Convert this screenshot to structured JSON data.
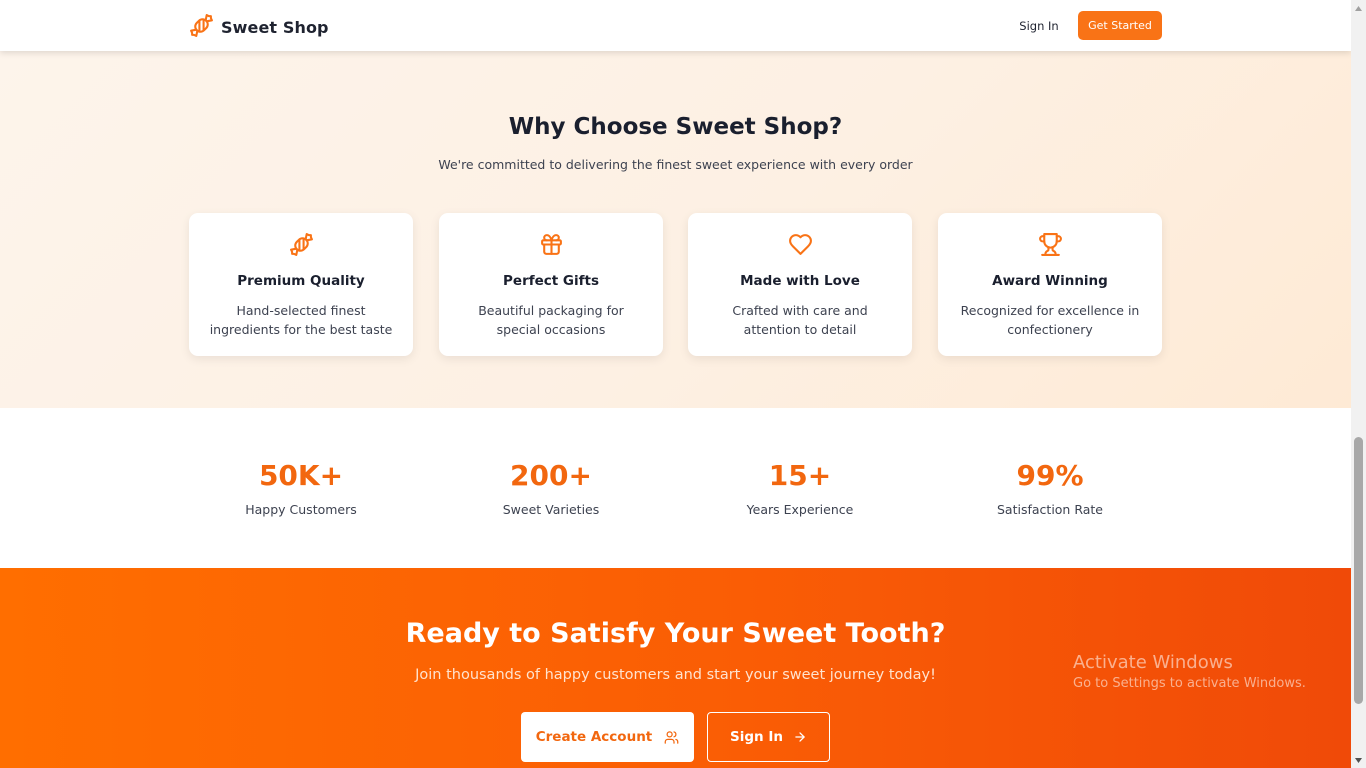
{
  "header": {
    "brand_name": "Sweet Shop",
    "brand_icon": "candy-icon",
    "sign_in_label": "Sign In",
    "cta_label": "Get Started"
  },
  "why": {
    "title": "Why Choose Sweet Shop?",
    "subtitle": "We're committed to delivering the finest sweet experience with every order",
    "features": [
      {
        "icon": "candy-icon",
        "title": "Premium Quality",
        "description": "Hand-selected finest ingredients for the best taste"
      },
      {
        "icon": "gift-icon",
        "title": "Perfect Gifts",
        "description": "Beautiful packaging for special occasions"
      },
      {
        "icon": "heart-icon",
        "title": "Made with Love",
        "description": "Crafted with care and attention to detail"
      },
      {
        "icon": "trophy-icon",
        "title": "Award Winning",
        "description": "Recognized for excellence in confectionery"
      }
    ]
  },
  "stats": [
    {
      "value": "50K+",
      "label": "Happy Customers"
    },
    {
      "value": "200+",
      "label": "Sweet Varieties"
    },
    {
      "value": "15+",
      "label": "Years Experience"
    },
    {
      "value": "99%",
      "label": "Satisfaction Rate"
    }
  ],
  "cta": {
    "title": "Ready to Satisfy Your Sweet Tooth?",
    "subtitle": "Join thousands of happy customers and start your sweet journey today!",
    "create_account_label": "Create Account",
    "sign_in_label": "Sign In"
  },
  "watermark": {
    "title": "Activate Windows",
    "subtitle": "Go to Settings to activate Windows."
  },
  "colors": {
    "accent": "#f97316",
    "stat_value": "#f2670f",
    "cta_gradient_start": "#ff6e00",
    "cta_gradient_end": "#f04a08"
  }
}
